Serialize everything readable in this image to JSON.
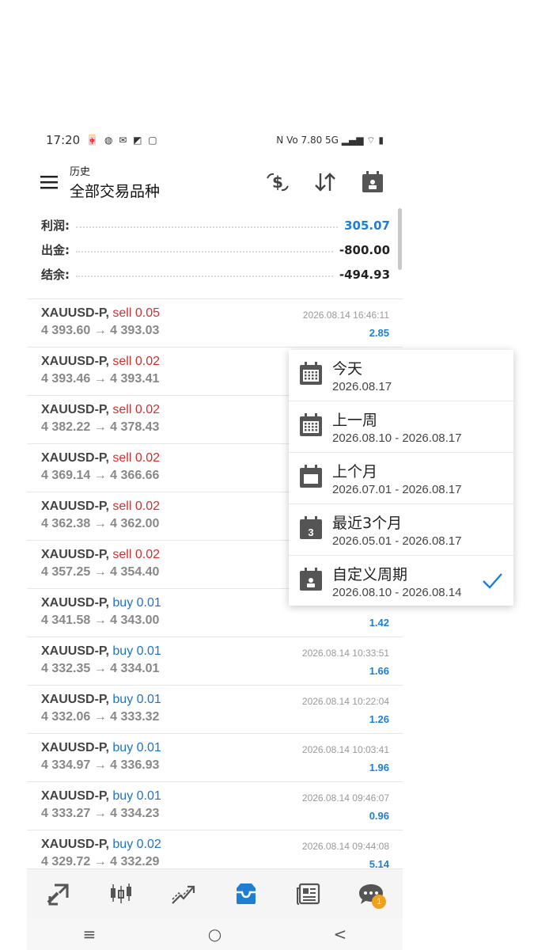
{
  "status_bar": {
    "time": "17:20",
    "left_icons": "🀄 ◍ ✉ ◩ ▢",
    "right_icons": "N  Vo 7.80 5G  ▂▄▆ ⌔ ▮"
  },
  "header": {
    "subtitle": "历史",
    "title": "全部交易品种"
  },
  "summary": [
    {
      "label": "利润:",
      "value": "305.07",
      "color": "#1f7ed4"
    },
    {
      "label": "出金:",
      "value": "-800.00",
      "color": "#222222"
    },
    {
      "label": "结余:",
      "value": "-494.93",
      "color": "#222222"
    }
  ],
  "trades": [
    {
      "symbol": "XAUUSD-P,",
      "side": "sell",
      "volume": "0.05",
      "prices": "4 393.60 → 4 393.03",
      "time": "2026.08.14 16:46:11",
      "profit": "2.85"
    },
    {
      "symbol": "XAUUSD-P,",
      "side": "sell",
      "volume": "0.02",
      "prices": "4 393.46 → 4 393.41",
      "time": "",
      "profit": ""
    },
    {
      "symbol": "XAUUSD-P,",
      "side": "sell",
      "volume": "0.02",
      "prices": "4 382.22 → 4 378.43",
      "time": "",
      "profit": ""
    },
    {
      "symbol": "XAUUSD-P,",
      "side": "sell",
      "volume": "0.02",
      "prices": "4 369.14 → 4 366.66",
      "time": "",
      "profit": ""
    },
    {
      "symbol": "XAUUSD-P,",
      "side": "sell",
      "volume": "0.02",
      "prices": "4 362.38 → 4 362.00",
      "time": "",
      "profit": ""
    },
    {
      "symbol": "XAUUSD-P,",
      "side": "sell",
      "volume": "0.02",
      "prices": "4 357.25 → 4 354.40",
      "time": "",
      "profit": ""
    },
    {
      "symbol": "XAUUSD-P,",
      "side": "buy",
      "volume": "0.01",
      "prices": "4 341.58 → 4 343.00",
      "time": "",
      "profit": "1.42"
    },
    {
      "symbol": "XAUUSD-P,",
      "side": "buy",
      "volume": "0.01",
      "prices": "4 332.35 → 4 334.01",
      "time": "2026.08.14 10:33:51",
      "profit": "1.66"
    },
    {
      "symbol": "XAUUSD-P,",
      "side": "buy",
      "volume": "0.01",
      "prices": "4 332.06 → 4 333.32",
      "time": "2026.08.14 10:22:04",
      "profit": "1.26"
    },
    {
      "symbol": "XAUUSD-P,",
      "side": "buy",
      "volume": "0.01",
      "prices": "4 334.97 → 4 336.93",
      "time": "2026.08.14 10:03:41",
      "profit": "1.96"
    },
    {
      "symbol": "XAUUSD-P,",
      "side": "buy",
      "volume": "0.01",
      "prices": "4 333.27 → 4 334.23",
      "time": "2026.08.14 09:46:07",
      "profit": "0.96"
    },
    {
      "symbol": "XAUUSD-P,",
      "side": "buy",
      "volume": "0.02",
      "prices": "4 329.72 → 4 332.29",
      "time": "2026.08.14 09:44:08",
      "profit": "5.14"
    }
  ],
  "period_menu": [
    {
      "label": "今天",
      "range": "2026.08.17",
      "icon": "calendar-today-icon",
      "selected": false
    },
    {
      "label": "上一周",
      "range": "2026.08.10 - 2026.08.17",
      "icon": "calendar-week-icon",
      "selected": false
    },
    {
      "label": "上个月",
      "range": "2026.07.01 - 2026.08.17",
      "icon": "calendar-month-icon",
      "selected": false
    },
    {
      "label": "最近3个月",
      "range": "2026.05.01 - 2026.08.17",
      "icon": "calendar-3-icon",
      "icon_text": "3",
      "selected": false
    },
    {
      "label": "自定义周期",
      "range": "2026.08.10 - 2026.08.14",
      "icon": "calendar-custom-icon",
      "selected": true
    }
  ],
  "bottom_nav": [
    {
      "name": "quotes-icon"
    },
    {
      "name": "chart-icon"
    },
    {
      "name": "trade-icon"
    },
    {
      "name": "history-icon",
      "active": true
    },
    {
      "name": "news-icon"
    },
    {
      "name": "messages-icon",
      "badge": "1"
    }
  ],
  "colors": {
    "accent": "#1f7ed4",
    "sell": "#d32f2f",
    "buy": "#1e73c8",
    "icon": "#555555"
  }
}
